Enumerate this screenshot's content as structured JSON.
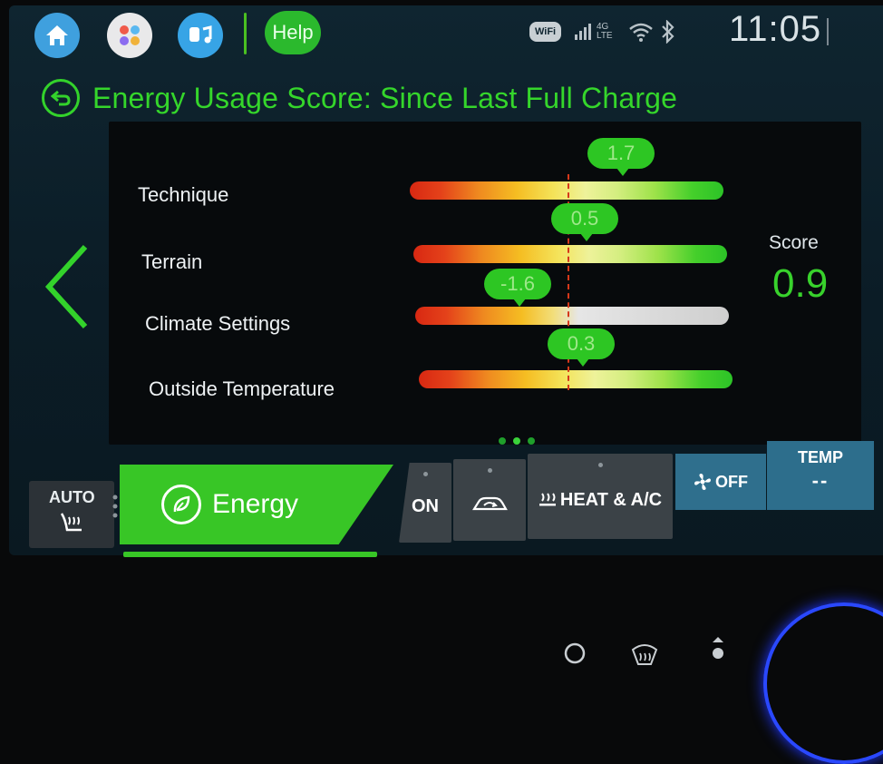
{
  "topbar": {
    "help_label": "Help",
    "wifi_label": "WiFi",
    "network_label": "4G LTE",
    "time": "11:05"
  },
  "page": {
    "title": "Energy Usage Score: Since Last Full Charge"
  },
  "factors": [
    {
      "label": "Technique",
      "value": "1.7"
    },
    {
      "label": "Terrain",
      "value": "0.5"
    },
    {
      "label": "Climate Settings",
      "value": "-1.6"
    },
    {
      "label": "Outside Temperature",
      "value": "0.3"
    }
  ],
  "score": {
    "label": "Score",
    "value": "0.9"
  },
  "pagination": {
    "count": 3,
    "active": 2
  },
  "climate": {
    "auto_label": "AUTO",
    "energy_label": "Energy",
    "on_label": "ON",
    "heat_ac_label": "HEAT & A/C",
    "fan_label": "OFF",
    "temp_label": "TEMP",
    "temp_value": "--"
  },
  "colors": {
    "accent_green": "#35d62b",
    "panel_background": "#070a0c",
    "screen_background": "#0f2530",
    "fan_blue": "#2f6f8d"
  },
  "icons": [
    "home-icon",
    "apps-icon",
    "media-icon",
    "wifi-icon",
    "signal-icon",
    "bluetooth-icon",
    "back-icon",
    "chevron-left-icon",
    "seat-heat-icon",
    "leaf-icon",
    "recirculation-icon",
    "heat-icon",
    "fan-icon",
    "search-icon",
    "defrost-icon",
    "airflow-icon"
  ]
}
